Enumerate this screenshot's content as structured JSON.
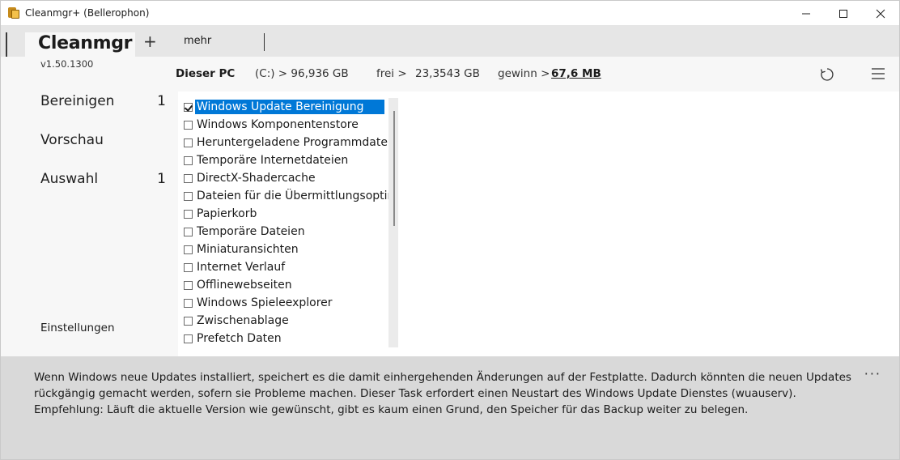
{
  "window": {
    "title": "Cleanmgr+ (Bellerophon)",
    "icons": {
      "app": "app-logo-icon",
      "minimize": "minimize-icon",
      "maximize": "maximize-icon",
      "close": "close-icon"
    }
  },
  "tabs": {
    "app_name": "Cleanmgr",
    "add": "+",
    "more": "mehr"
  },
  "sidebar": {
    "version": "v1.50.1300",
    "items": [
      {
        "label": "Bereinigen",
        "count": "1"
      },
      {
        "label": "Vorschau",
        "count": ""
      },
      {
        "label": "Auswahl",
        "count": "1"
      }
    ],
    "settings": "Einstellungen"
  },
  "header": {
    "pc": "Dieser PC",
    "drive": "(C:) > 96,936 GB",
    "free_label": "frei >",
    "free_value": "23,3543 GB",
    "gain_label": "gewinn >",
    "gain_value": "67,6 MB",
    "icons": {
      "refresh": "refresh-icon",
      "menu": "hamburger-menu-icon"
    }
  },
  "list": {
    "items": [
      {
        "label": "Windows Update Bereinigung",
        "checked": true,
        "selected": true
      },
      {
        "label": "Windows Komponentenstore",
        "checked": false
      },
      {
        "label": "Heruntergeladene Programmdateie",
        "checked": false
      },
      {
        "label": "Temporäre Internetdateien",
        "checked": false
      },
      {
        "label": "DirectX-Shadercache",
        "checked": false
      },
      {
        "label": "Dateien für die Übermittlungsoptim",
        "checked": false
      },
      {
        "label": "Papierkorb",
        "checked": false
      },
      {
        "label": "Temporäre Dateien",
        "checked": false
      },
      {
        "label": "Miniaturansichten",
        "checked": false
      },
      {
        "label": "Internet Verlauf",
        "checked": false
      },
      {
        "label": "Offlinewebseiten",
        "checked": false
      },
      {
        "label": "Windows Spieleexplorer",
        "checked": false
      },
      {
        "label": "Zwischenablage",
        "checked": false
      },
      {
        "label": "Prefetch Daten",
        "checked": false
      }
    ]
  },
  "description": {
    "lines": [
      "Wenn Windows neue Updates installiert, speichert es die damit einhergehenden Änderungen auf der Festplatte. Dadurch könnten die neuen Updates",
      "rückgängig gemacht werden, sofern sie Probleme machen. Dieser Task erfordert einen Neustart des Windows Update Dienstes (wuauserv).",
      "Empfehlung: Läuft die aktuelle Version wie gewünscht, gibt es kaum einen Grund, den Speicher für das Backup weiter zu belegen."
    ],
    "more": "···"
  },
  "colors": {
    "accent": "#0078d7",
    "panel": "#f7f7f7",
    "tabstrip": "#e6e6e6",
    "description_bg": "#d9d9d9"
  }
}
